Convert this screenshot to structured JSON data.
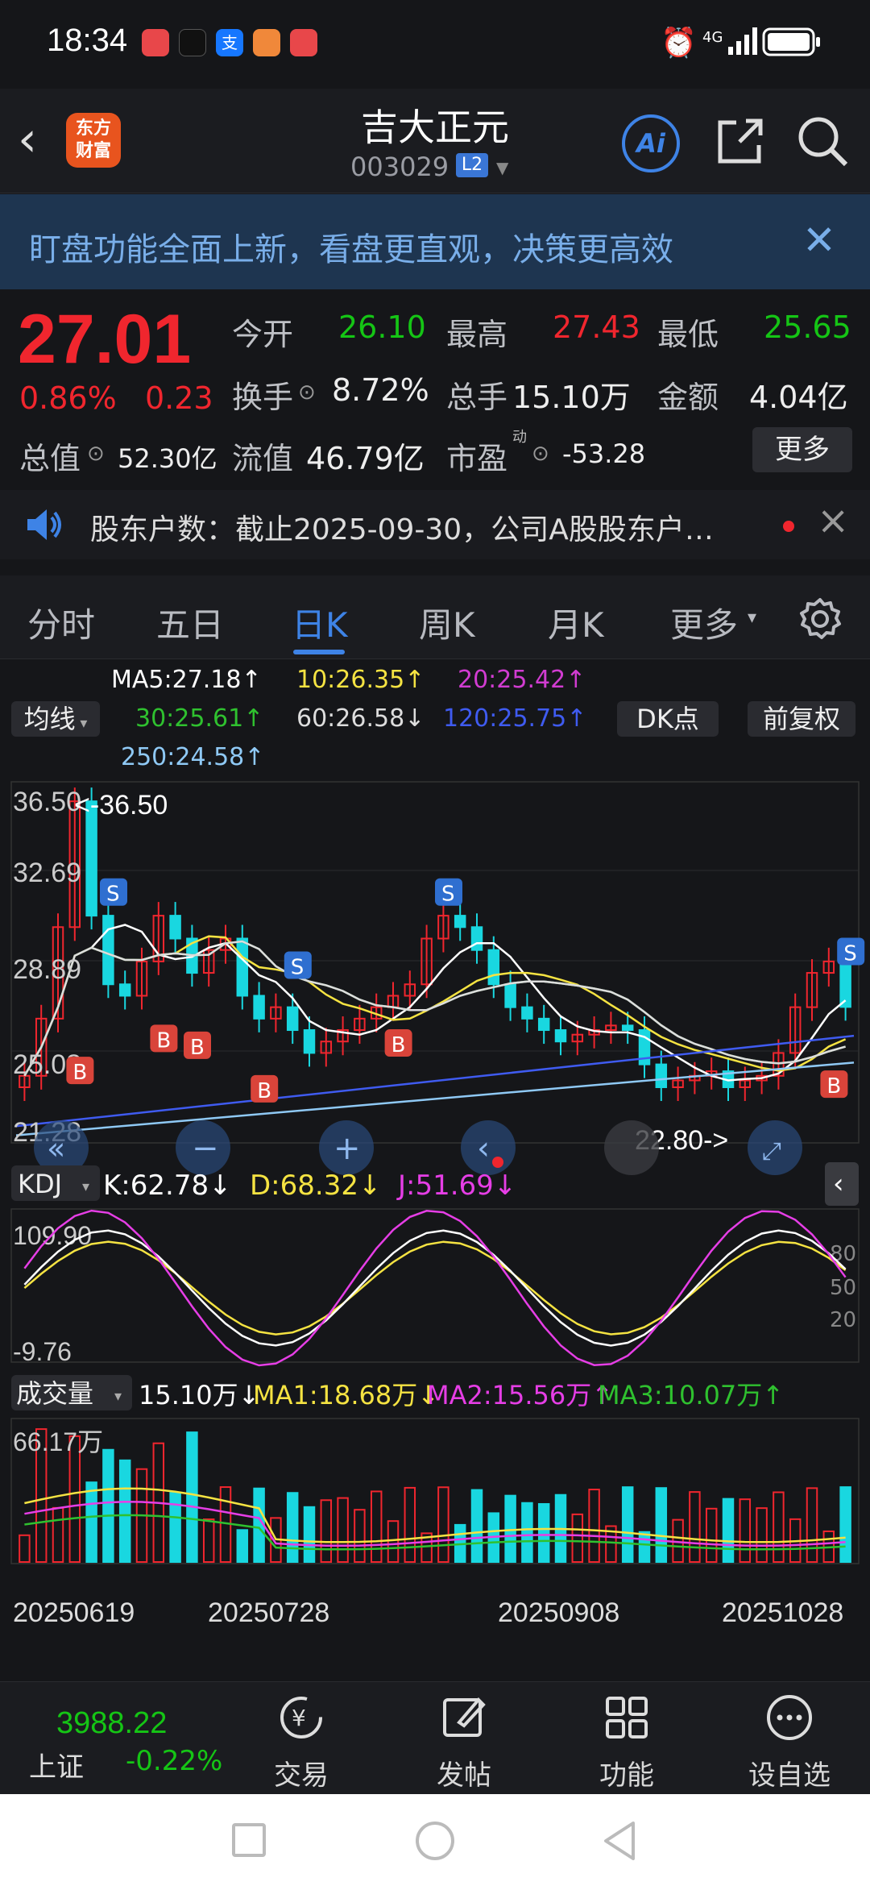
{
  "status_bar": {
    "time": "18:34",
    "network": "4G"
  },
  "header": {
    "stock_name": "吉大正元",
    "stock_code": "003029",
    "level_badge": "L2",
    "logo_text_1": "东方",
    "logo_text_2": "财富",
    "ai_label": "Ai"
  },
  "banner": {
    "text": "盯盘功能全面上新，看盘更直观，决策更高效"
  },
  "quote": {
    "price": "27.01",
    "change_pct": "0.86%",
    "change": "0.23",
    "open_label": "今开",
    "open": "26.10",
    "high_label": "最高",
    "high": "27.43",
    "low_label": "最低",
    "low": "25.65",
    "turnover_label": "换手",
    "turnover": "8.72%",
    "volume_label": "总手",
    "volume": "15.10万",
    "amount_label": "金额",
    "amount": "4.04亿",
    "mktcap_label": "总值",
    "mktcap": "52.30亿",
    "float_label": "流值",
    "float": "46.79亿",
    "pe_label": "市盈",
    "pe_sup": "动",
    "pe": "-53.28",
    "more_label": "更多"
  },
  "notice": {
    "text": "股东户数：截止2025-09-30，公司A股股东户…"
  },
  "tabs": [
    "分时",
    "五日",
    "日K",
    "周K",
    "月K",
    "更多"
  ],
  "active_tab": "日K",
  "ma": {
    "selector": "均线",
    "ma5": "MA5:27.18↑",
    "ma10": "10:26.35↑",
    "ma20": "20:25.42↑",
    "ma30": "30:25.61↑",
    "ma60": "60:26.58↓",
    "ma120": "120:25.75↑",
    "ma250": "250:24.58↑",
    "dk_label": "DK点",
    "adjust_label": "前复权",
    "colors": {
      "ma5": "#ffffff",
      "ma10": "#f5e342",
      "ma20": "#d13cd1",
      "ma30": "#2fc12f",
      "ma60": "#dddddd",
      "ma120": "#3f5bf0",
      "ma250": "#8fc9f5"
    }
  },
  "kline": {
    "y_labels": [
      "36.50",
      "32.69",
      "28.89",
      "25.08",
      "21.28"
    ],
    "high_marker": "<-36.50",
    "low_marker": "22.80->"
  },
  "kdj": {
    "selector": "KDJ",
    "k": "K:62.78↓",
    "d": "D:68.32↓",
    "j": "J:51.69↓",
    "y_top": "109.90",
    "y_bottom": "-9.76",
    "r80": "80",
    "r50": "50",
    "r20": "20"
  },
  "volume": {
    "selector": "成交量",
    "vol": "15.10万↓",
    "ma1": "MA1:18.68万↓",
    "ma2": "MA2:15.56万↑",
    "ma3": "MA3:10.07万↑",
    "y_top": "66.17万"
  },
  "dates": [
    "20250619",
    "20250728",
    "20250908",
    "20251028"
  ],
  "bottom": {
    "index_value": "3988.22",
    "index_name": "上证",
    "index_change": "-0.22%",
    "trade": "交易",
    "post": "发帖",
    "func": "功能",
    "watch": "设自选"
  },
  "chart_data": {
    "type": "candlestick",
    "title": "",
    "price_range": [
      21.28,
      36.5
    ],
    "high": 36.5,
    "low": 22.8,
    "close_series": [
      24.0,
      26.5,
      30.5,
      36.0,
      31.0,
      28.0,
      27.5,
      29.0,
      31.0,
      30.0,
      28.5,
      29.5,
      30.0,
      27.5,
      26.5,
      27.0,
      26.0,
      25.0,
      25.5,
      26.0,
      26.5,
      27.0,
      27.5,
      28.0,
      30.0,
      31.0,
      30.5,
      29.5,
      28.0,
      27.0,
      26.5,
      26.0,
      25.5,
      25.8,
      26.0,
      26.2,
      26.0,
      24.5,
      23.5,
      23.8,
      24.0,
      24.2,
      23.5,
      23.8,
      24.0,
      25.0,
      27.0,
      28.5,
      29.0,
      27.01
    ],
    "kdj": {
      "k": 62.78,
      "d": 68.32,
      "j": 51.69,
      "range": [
        -9.76,
        109.9
      ]
    },
    "volume": {
      "latest": "15.10万",
      "max": "66.17万"
    }
  }
}
